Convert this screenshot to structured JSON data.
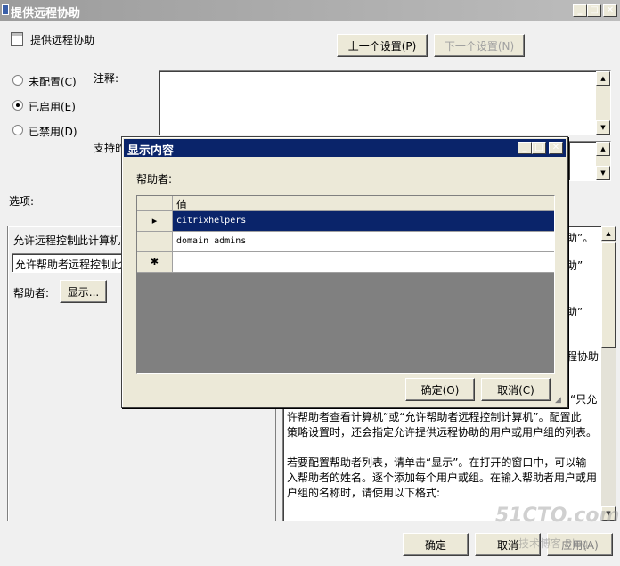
{
  "window": {
    "title": "提供远程协助",
    "policy_name": "提供远程协助",
    "prev_button": "上一个设置(P)",
    "next_button": "下一个设置(N)"
  },
  "state": {
    "not_configured": "未配置(C)",
    "enabled": "已启用(E)",
    "disabled": "已禁用(D)",
    "selected": "enabled"
  },
  "labels": {
    "comment": "注释:",
    "supported_on_partial": "支持的",
    "options": "选项:"
  },
  "options_panel": {
    "line1": "允许远程控制此计算机:",
    "dropdown_value": "允许帮助者远程控制此",
    "helpers_label": "帮助者:",
    "show_button": "显示..."
  },
  "help_panel": {
    "frag1": "助”。",
    "frag2": "助”",
    "frag3": "助”",
    "frag4": "程协助",
    "frag5": "“只允",
    "line1": "许帮助者查看计算机”或“允许帮助者远程控制计算机”。配置此",
    "line2": "策略设置时，还会指定允许提供远程协助的用户或用户组的列表。",
    "line3": "若要配置帮助者列表，请单击“显示”。在打开的窗口中，可以输",
    "line4": "入帮助者的姓名。逐个添加每个用户或组。在输入帮助者用户或用",
    "line5": "户组的名称时，请使用以下格式:"
  },
  "footer": {
    "ok": "确定",
    "cancel": "取消",
    "apply": "应用(A)"
  },
  "dialog": {
    "title": "显示内容",
    "helpers_label": "帮助者:",
    "column_header": "值",
    "rows": [
      {
        "marker": "▸",
        "value": "citrixhelpers",
        "selected": true
      },
      {
        "marker": "",
        "value": "domain admins",
        "selected": false
      },
      {
        "marker": "✱",
        "value": "",
        "selected": false
      }
    ],
    "ok": "确定(O)",
    "cancel": "取消(C)"
  },
  "watermark": {
    "site": "51CTO.com",
    "sub": "技术博客 Blog"
  }
}
